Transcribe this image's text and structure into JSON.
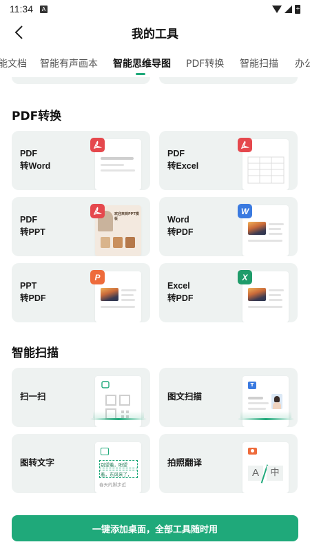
{
  "status_bar": {
    "time": "11:34",
    "notif_letter": "A"
  },
  "header": {
    "title": "我的工具"
  },
  "tabs": [
    {
      "label": "能文档"
    },
    {
      "label": "智能有声画本"
    },
    {
      "label": "智能思维导图"
    },
    {
      "label": "PDF转换"
    },
    {
      "label": "智能扫描"
    },
    {
      "label": "办公"
    }
  ],
  "active_tab": "智能思维导图",
  "sections": {
    "pdf": {
      "title": "PDF转换",
      "cards": [
        {
          "line1": "PDF",
          "line2": "转Word",
          "badge": "pdf-icon"
        },
        {
          "line1": "PDF",
          "line2": "转Excel",
          "badge": "pdf-icon"
        },
        {
          "line1": "PDF",
          "line2": "转PPT",
          "badge": "pdf-icon"
        },
        {
          "line1": "Word",
          "line2": "转PDF",
          "badge_text": "W"
        },
        {
          "line1": "PPT",
          "line2": "转PDF",
          "badge_text": "P"
        },
        {
          "line1": "Excel",
          "line2": "转PDF",
          "badge_text": "X"
        }
      ]
    },
    "scan": {
      "title": "智能扫描",
      "cards": [
        {
          "label": "扫一扫"
        },
        {
          "label": "图文扫描"
        },
        {
          "label": "图转文字",
          "sample_lines": [
            "别望着，盼望",
            "着，东风来了，",
            "春天的脚步近"
          ]
        },
        {
          "label": "拍照翻译",
          "from": "A",
          "to": "中"
        }
      ]
    }
  },
  "ppt_thumb_text": "欢迎来到PPT模板",
  "cta": {
    "label": "一键添加桌面，全部工具随时用"
  },
  "colors": {
    "accent": "#1fa97a",
    "pdf_red": "#e5484d",
    "word_blue": "#3a7ae0",
    "ppt_orange": "#ee6b3b",
    "excel_green": "#1f9c6a",
    "card_bg": "#eef2f1"
  }
}
